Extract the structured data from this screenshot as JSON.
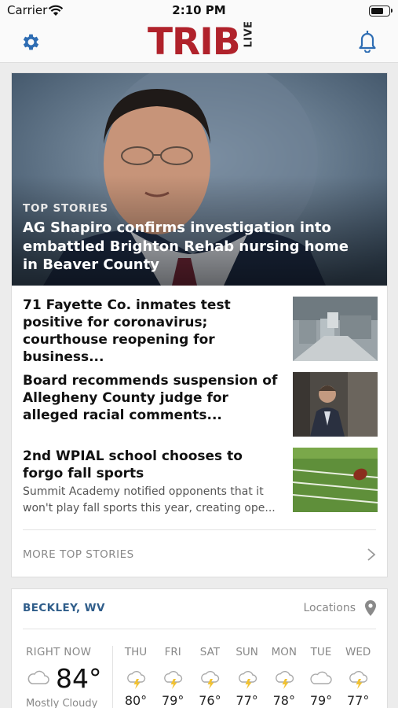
{
  "status_bar": {
    "carrier": "Carrier",
    "time": "2:10 PM",
    "battery_level": 0.75
  },
  "header": {
    "logo_main": "TRIB",
    "logo_sub": "LIVE"
  },
  "top_stories": {
    "hero": {
      "kicker": "TOP STORIES",
      "title": "AG Shapiro confirms investigation into embattled Brighton Rehab nursing home in Beaver County"
    },
    "items": [
      {
        "title": "71 Fayette Co. inmates test positive for coronavirus; courthouse reopening for business...",
        "summary": ""
      },
      {
        "title": "Board recommends suspension of Allegheny County judge for alleged racial comments...",
        "summary": ""
      },
      {
        "title": "2nd WPIAL school chooses to forgo fall sports",
        "summary": "Summit Academy notified opponents that it won't play fall sports this year, creating ope..."
      }
    ],
    "more_label": "MORE TOP STORIES"
  },
  "weather": {
    "location": "BECKLEY, WV",
    "locations_label": "Locations",
    "now_label": "RIGHT NOW",
    "now_temp": "84°",
    "now_condition": "Mostly Cloudy",
    "forecast": [
      {
        "day": "THU",
        "temp": "80°",
        "icon": "thunderstorm-icon"
      },
      {
        "day": "FRI",
        "temp": "79°",
        "icon": "thunderstorm-icon"
      },
      {
        "day": "SAT",
        "temp": "76°",
        "icon": "thunderstorm-icon"
      },
      {
        "day": "SUN",
        "temp": "77°",
        "icon": "thunderstorm-icon"
      },
      {
        "day": "MON",
        "temp": "78°",
        "icon": "thunderstorm-icon"
      },
      {
        "day": "TUE",
        "temp": "79°",
        "icon": "cloudy-icon"
      },
      {
        "day": "WED",
        "temp": "77°",
        "icon": "thunderstorm-icon"
      }
    ]
  },
  "colors": {
    "brand": "#b0222b",
    "accent": "#2f5d8a",
    "icon_yellow": "#f2c230"
  }
}
